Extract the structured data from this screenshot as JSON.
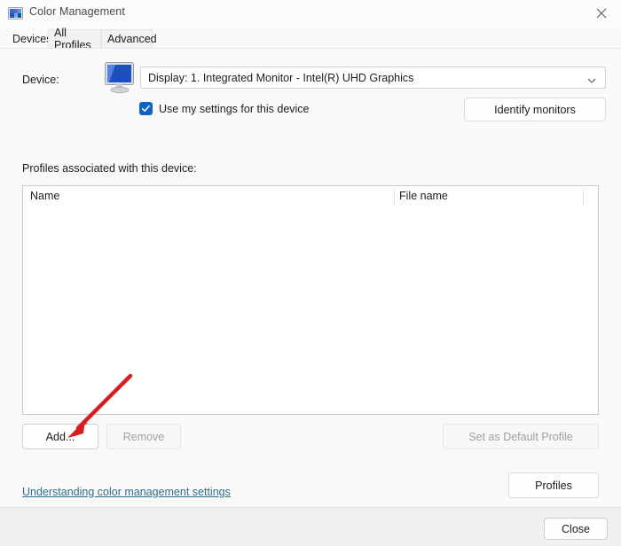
{
  "window": {
    "title": "Color Management",
    "icon": "color-management-icon",
    "close_icon": "close-icon"
  },
  "tabs": [
    {
      "label": "Devices",
      "selected": true
    },
    {
      "label": "All Profiles",
      "selected": false
    },
    {
      "label": "Advanced",
      "selected": false
    }
  ],
  "device_section": {
    "label": "Device:",
    "icon": "monitor-icon",
    "selected_device": "Display: 1. Integrated Monitor - Intel(R) UHD Graphics",
    "chevron_icon": "chevron-down-icon",
    "checkbox": {
      "label": "Use my settings for this device",
      "checked": true,
      "accent_color": "#0f62c8"
    },
    "identify_button": "Identify monitors"
  },
  "profiles_section": {
    "label": "Profiles associated with this device:",
    "columns": [
      "Name",
      "File name"
    ],
    "rows": [],
    "add_button": "Add...",
    "remove_button": "Remove",
    "remove_disabled": true,
    "set_default_button": "Set as Default Profile",
    "set_default_disabled": true
  },
  "footer_links": {
    "help_link": "Understanding color management settings",
    "help_link_color": "#2e6f8e",
    "profiles_button": "Profiles"
  },
  "footer": {
    "close_button": "Close"
  },
  "annotation": {
    "type": "arrow",
    "color": "#d81f1f",
    "points_to": "add-button"
  }
}
